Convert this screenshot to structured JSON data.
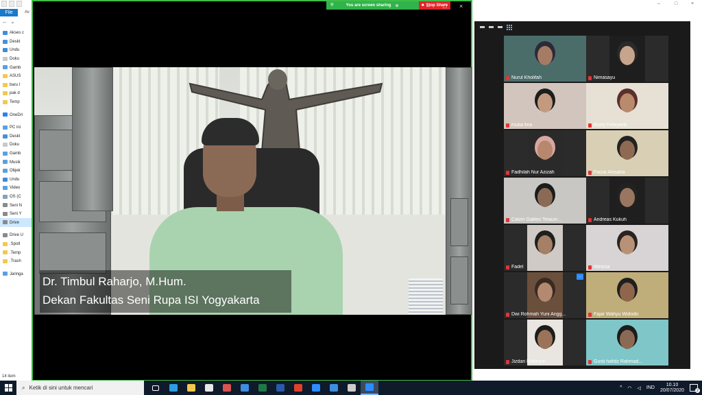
{
  "explorer": {
    "file_tab": "File",
    "ribbon_rest": "Av",
    "tree": [
      {
        "label": "Akses c",
        "color": "#3d8ee0"
      },
      {
        "label": "Deskt",
        "color": "#4a90d9"
      },
      {
        "label": "Undu",
        "color": "#3f8ad8"
      },
      {
        "label": "Doku",
        "color": "#c9c9c9"
      },
      {
        "label": "Gamb",
        "color": "#5aa0e0"
      },
      {
        "label": "ASUS",
        "color": "#f2c94c"
      },
      {
        "label": "baru I",
        "color": "#f2c94c"
      },
      {
        "label": "pak d",
        "color": "#f2c94c"
      },
      {
        "label": "Temp",
        "color": "#f2c94c"
      },
      {
        "label": "OneDri",
        "color": "#2f80ed"
      },
      {
        "label": "PC ini",
        "color": "#5aa0e0"
      },
      {
        "label": "Deskt",
        "color": "#4a90d9"
      },
      {
        "label": "Doku",
        "color": "#c9c9c9"
      },
      {
        "label": "Gamb",
        "color": "#5aa0e0"
      },
      {
        "label": "Musik",
        "color": "#5aa0e0"
      },
      {
        "label": "Objek",
        "color": "#5aa0e0"
      },
      {
        "label": "Undu",
        "color": "#3f8ad8"
      },
      {
        "label": "Video",
        "color": "#5aa0e0"
      },
      {
        "label": "OS (C",
        "color": "#8aa0b8"
      },
      {
        "label": "Seni N",
        "color": "#8a8a8a"
      },
      {
        "label": "Seni Y",
        "color": "#8a8a8a"
      },
      {
        "label": "Drive",
        "color": "#8a8a8a"
      },
      {
        "label": "Drive U",
        "color": "#8a8a8a"
      },
      {
        "label": ".Spotl",
        "color": "#f2c94c"
      },
      {
        "label": ".Temp",
        "color": "#f2c94c"
      },
      {
        "label": ".Trash",
        "color": "#f2c94c"
      },
      {
        "label": "Jaringa",
        "color": "#5aa0e0"
      }
    ],
    "status": "14 item"
  },
  "zoom_main": {
    "sharing_text": "You are screen sharing",
    "stop_share": "Stop Share",
    "minimize": "–",
    "maximize": "□",
    "close": "×",
    "speaker_name": "Dr. Timbul Raharjo, M.Hum.",
    "speaker_title": "Dekan Fakultas Seni Rupa ISI Yogyakarta"
  },
  "gallery": {
    "minimize": "–",
    "maximize": "□",
    "close": "×",
    "more_button": "···",
    "participants": [
      {
        "name": "Nurul Kholifah",
        "bg": "#4a6d6a",
        "skin": "#a57c63",
        "hair": "#2b2a3a"
      },
      {
        "name": "Nimasayu",
        "bg": "#1e1e1e",
        "skin": "#c7a58d",
        "hair": "#2a2a2a"
      },
      {
        "name": "mutia fina",
        "bg": "#d2c5bd",
        "skin": "#c49a7f",
        "hair": "#1d1d1d"
      },
      {
        "name": "Rizky Febryanti",
        "bg": "#e6e1d4",
        "skin": "#b98a6c",
        "hair": "#5b2f2a"
      },
      {
        "name": "Fadhilah Nur Azizah",
        "bg": "#2a2a2a",
        "skin": "#b7876e",
        "hair": "#d8a7a0"
      },
      {
        "name": "Faizal Alrisaha",
        "bg": "#d9cfb5",
        "skin": "#8f6a52",
        "hair": "#222"
      },
      {
        "name": "Calvin Galileo Telaum...",
        "bg": "#c8c7c4",
        "skin": "#8b6a55",
        "hair": "#1c1c1c"
      },
      {
        "name": "Andreas Kukuh",
        "bg": "#1f1f1f",
        "skin": "#9a7660",
        "hair": "#222"
      },
      {
        "name": "Fadel",
        "bg": "#cfcac5",
        "skin": "#a57f66",
        "hair": "#1f1f1f"
      },
      {
        "name": "Winosa",
        "bg": "#d8d4d5",
        "skin": "#b89276",
        "hair": "#2b2320"
      },
      {
        "name": "Dwi Rohmah Yuni Angg...",
        "bg": "#6a4f3c",
        "skin": "#b38a6f",
        "hair": "#3a2a20"
      },
      {
        "name": "Fajar Wahyu Widodo",
        "bg": "#bfae7a",
        "skin": "#8f664c",
        "hair": "#1f1f1f"
      },
      {
        "name": "Jizdan Mabrurin",
        "bg": "#e9e6e2",
        "skin": "#9c7358",
        "hair": "#1c1c1c"
      },
      {
        "name": "Gusti hafidz Rahmad...",
        "bg": "#7fc6c9",
        "skin": "#8b6a55",
        "hair": "#1c1c1c"
      }
    ]
  },
  "taskbar": {
    "search_placeholder": "Ketik di sini untuk mencari",
    "apps": [
      {
        "name": "task-view",
        "color": "#ffffff"
      },
      {
        "name": "edge",
        "color": "#2f9be0"
      },
      {
        "name": "file-explorer",
        "color": "#f2c94c"
      },
      {
        "name": "store",
        "color": "#e7e7e7"
      },
      {
        "name": "gift-app",
        "color": "#d9534f"
      },
      {
        "name": "mail",
        "color": "#3d8ee0"
      },
      {
        "name": "excel",
        "color": "#1e7a45"
      },
      {
        "name": "word",
        "color": "#2b5aab"
      },
      {
        "name": "wps",
        "color": "#e0412b"
      },
      {
        "name": "zoom",
        "color": "#2d8cff"
      },
      {
        "name": "photos",
        "color": "#3d8ee0"
      },
      {
        "name": "settings",
        "color": "#cccccc"
      },
      {
        "name": "zoom-active",
        "color": "#2d8cff"
      }
    ],
    "language": "IND",
    "time": "10.10",
    "date": "20/07/2020",
    "notification_count": "2"
  }
}
